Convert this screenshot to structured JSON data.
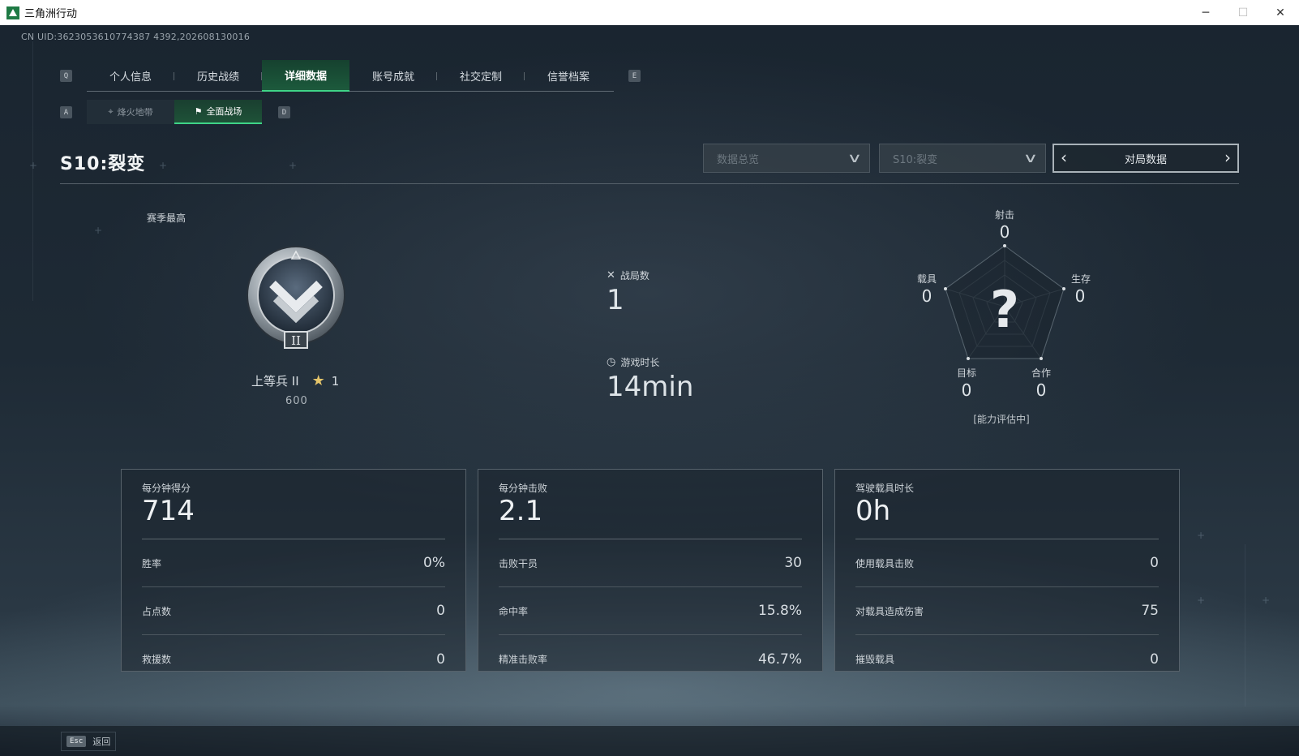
{
  "window": {
    "title": "三角洲行动",
    "minimize": "─",
    "maximize": "☐",
    "close": "✕"
  },
  "uid": "CN UID:3623053610774387 4392,202608130016",
  "tabs": {
    "prev_key": "Q",
    "next_key": "E",
    "items": [
      "个人信息",
      "历史战绩",
      "详细数据",
      "账号成就",
      "社交定制",
      "信誉档案"
    ],
    "active_index": 2
  },
  "subtabs": {
    "prev_key": "A",
    "next_key": "D",
    "items": [
      {
        "label": "烽火地带",
        "icon": "crosshair-icon"
      },
      {
        "label": "全面战场",
        "icon": "flag-icon"
      }
    ],
    "active_index": 1
  },
  "season": {
    "title": "S10:裂变"
  },
  "filters": {
    "mode_placeholder": "数据总览",
    "season_placeholder": "S10:裂变",
    "switcher_label": "对局数据"
  },
  "rank": {
    "section_label": "赛季最高",
    "name": "上等兵 II",
    "stars": "1",
    "points": "600",
    "tier_numeral": "II"
  },
  "summary": {
    "matches_label": "战局数",
    "matches_value": "1",
    "playtime_label": "游戏时长",
    "playtime_value": "14min"
  },
  "radar": {
    "center_mark": "?",
    "axes": [
      {
        "label": "射击",
        "value": "0"
      },
      {
        "label": "生存",
        "value": "0"
      },
      {
        "label": "合作",
        "value": "0"
      },
      {
        "label": "目标",
        "value": "0"
      },
      {
        "label": "载具",
        "value": "0"
      }
    ],
    "note": "[能力评估中]"
  },
  "cards": [
    {
      "head_label": "每分钟得分",
      "head_value": "714",
      "rows": [
        {
          "label": "胜率",
          "value": "0%"
        },
        {
          "label": "占点数",
          "value": "0"
        },
        {
          "label": "救援数",
          "value": "0"
        }
      ]
    },
    {
      "head_label": "每分钟击败",
      "head_value": "2.1",
      "rows": [
        {
          "label": "击败干员",
          "value": "30"
        },
        {
          "label": "命中率",
          "value": "15.8%"
        },
        {
          "label": "精准击败率",
          "value": "46.7%"
        }
      ]
    },
    {
      "head_label": "驾驶载具时长",
      "head_value": "0h",
      "rows": [
        {
          "label": "使用载具击败",
          "value": "0"
        },
        {
          "label": "对载具造成伤害",
          "value": "75"
        },
        {
          "label": "摧毁载具",
          "value": "0"
        }
      ]
    }
  ],
  "footer": {
    "esc_key": "Esc",
    "esc_label": "返回"
  }
}
